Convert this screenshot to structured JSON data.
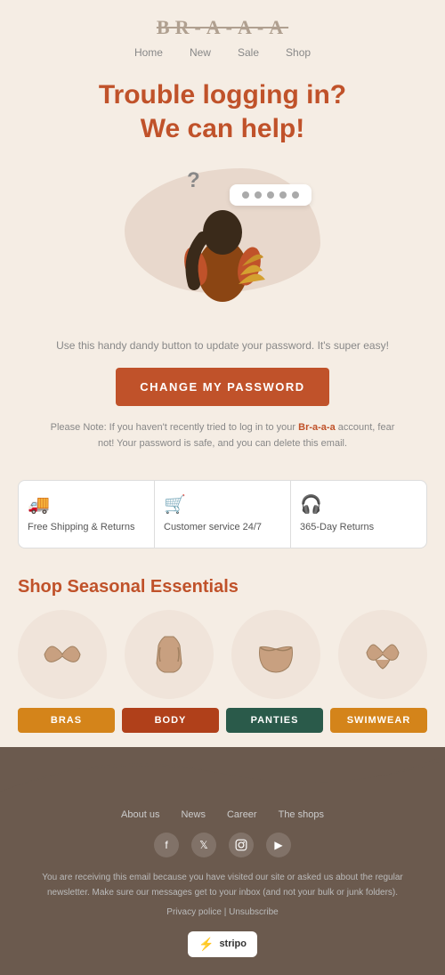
{
  "header": {
    "logo": "BR-A-A-A",
    "nav": [
      {
        "label": "Home"
      },
      {
        "label": "New"
      },
      {
        "label": "Sale"
      },
      {
        "label": "Shop"
      }
    ]
  },
  "hero": {
    "title_line1": "Trouble logging in?",
    "title_line2": "We can help!"
  },
  "body": {
    "intro_text": "Use this handy dandy button to update your password. It's super easy!",
    "cta_label": "CHANGE MY PASSWORD",
    "note": "Please Note: If you haven't recently tried to log in to your Br-a-a-a account, fear not! Your password is safe, and you can delete this email."
  },
  "features": [
    {
      "icon": "🚚",
      "label": "Free Shipping & Returns"
    },
    {
      "icon": "🛒",
      "label": "Customer service 24/7"
    },
    {
      "icon": "🎧",
      "label": "365-Day Returns"
    }
  ],
  "seasonal": {
    "title": "Shop Seasonal Essentials",
    "products": [
      {
        "label": "BRAS",
        "color_class": "label-bras"
      },
      {
        "label": "BODY",
        "color_class": "label-body"
      },
      {
        "label": "PANTIES",
        "color_class": "label-panties"
      },
      {
        "label": "SWIMWEAR",
        "color_class": "label-swimwear"
      }
    ]
  },
  "footer": {
    "nav": [
      {
        "label": "About us"
      },
      {
        "label": "News"
      },
      {
        "label": "Career"
      },
      {
        "label": "The shops"
      }
    ],
    "social": [
      {
        "icon": "f",
        "name": "facebook"
      },
      {
        "icon": "t",
        "name": "twitter"
      },
      {
        "icon": "i",
        "name": "instagram"
      },
      {
        "icon": "▶",
        "name": "youtube"
      }
    ],
    "disclaimer": "You are receiving this email because you have visited our site or asked us about the regular newsletter. Make sure our messages get to your inbox (and not your bulk or junk folders).",
    "links": "Privacy police | Unsubscribe",
    "badge_label": "stripo"
  }
}
